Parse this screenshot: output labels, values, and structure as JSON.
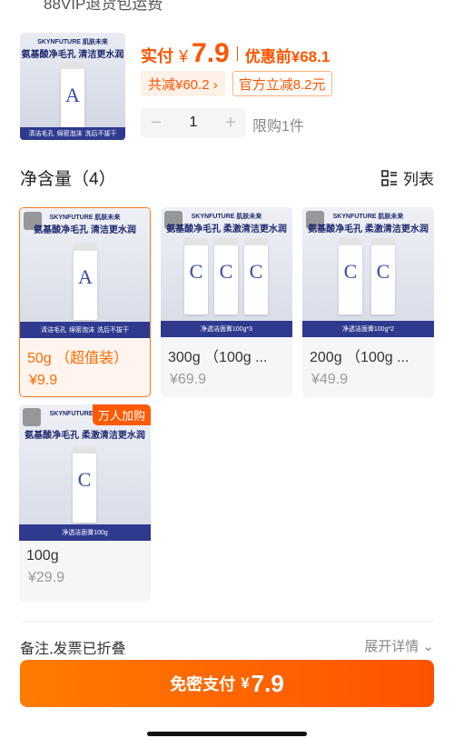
{
  "top_clip_text": "88VIP退货包运费",
  "header": {
    "price_label": "实付",
    "price_yen": "¥",
    "price_value": "7.9",
    "price_before": "优惠前¥68.1",
    "discount_tag": "共减¥60.2 ›",
    "official_tag": "官方立减8.2元",
    "quantity": "1",
    "minus": "−",
    "plus": "+",
    "limit_text": "限购1件"
  },
  "section": {
    "title": "净含量（4）",
    "view_label": "列表"
  },
  "product_image": {
    "brand": "SKYNFUTURE 肌肤未来",
    "claim_single": "氨基酸净毛孔  清洁更水润",
    "claim_multi": "氨基酸净毛孔 柔激清洁更水润",
    "features": [
      "清洁毛孔",
      "绵密泡沫",
      "洗后不拔干"
    ],
    "tube_letter_a": "A",
    "tube_letter_c": "C"
  },
  "options": [
    {
      "name": "50g （超值装）",
      "price": "¥9.9",
      "selected": true,
      "caption": "",
      "badge": ""
    },
    {
      "name": "300g （100g ...",
      "price": "¥69.9",
      "selected": false,
      "caption": "净透洁面膏100g*3",
      "badge": ""
    },
    {
      "name": "200g （100g ...",
      "price": "¥49.9",
      "selected": false,
      "caption": "净透洁面膏100g*2",
      "badge": ""
    },
    {
      "name": "100g",
      "price": "¥29.9",
      "selected": false,
      "caption": "净透洁面膏100g",
      "badge": "万人加购"
    }
  ],
  "remark": {
    "label": "备注,发票已折叠",
    "expand": "展开详情"
  },
  "pay_button": {
    "label": "免密支付",
    "yen": "¥",
    "amount": "7.9"
  },
  "colors": {
    "accent": "#ff5500",
    "brand_blue": "#2f3a8f"
  }
}
